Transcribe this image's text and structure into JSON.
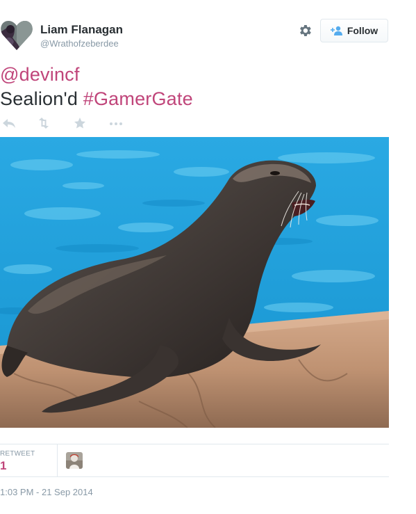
{
  "author": {
    "name": "Liam Flanagan",
    "handle": "@Wrathofzeberdee"
  },
  "header": {
    "follow_label": "Follow"
  },
  "tweet": {
    "mention": "@devincf",
    "text_plain": "Sealion'd ",
    "hashtag": "#GamerGate"
  },
  "actions": {
    "icons": [
      "reply-icon",
      "retweet-icon",
      "favorite-icon",
      "more-icon"
    ]
  },
  "stats": {
    "retweet_label": "RETWEET",
    "retweet_count": "1"
  },
  "timestamp": "1:03 PM - 21 Sep 2014",
  "colors": {
    "link": "#c0457a",
    "muted": "#8899a6",
    "text": "#292f33",
    "divider": "#e1e8ed",
    "action_icon": "#ccd6dd",
    "follow_icon": "#55acee",
    "water": "#1e9fd8"
  }
}
